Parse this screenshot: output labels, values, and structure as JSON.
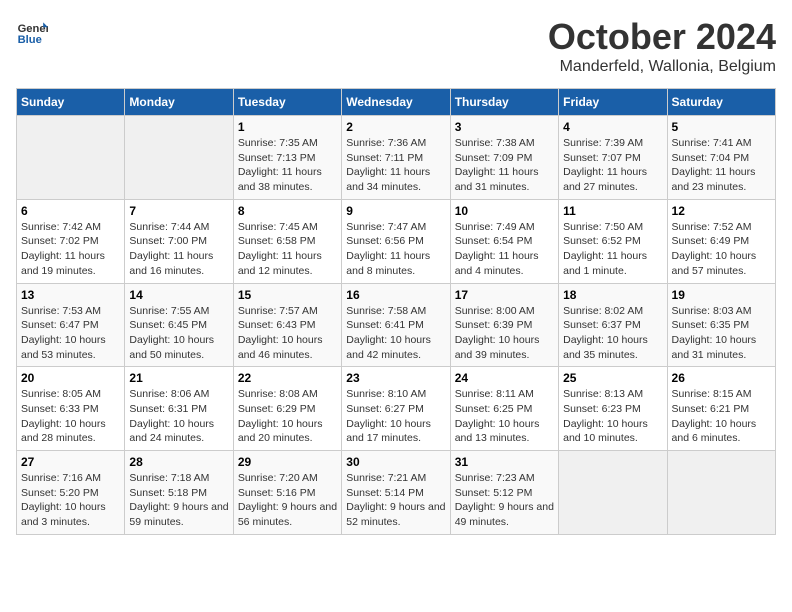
{
  "header": {
    "logo_general": "General",
    "logo_blue": "Blue",
    "month_title": "October 2024",
    "location": "Manderfeld, Wallonia, Belgium"
  },
  "days_of_week": [
    "Sunday",
    "Monday",
    "Tuesday",
    "Wednesday",
    "Thursday",
    "Friday",
    "Saturday"
  ],
  "weeks": [
    [
      {
        "num": "",
        "info": ""
      },
      {
        "num": "",
        "info": ""
      },
      {
        "num": "1",
        "info": "Sunrise: 7:35 AM\nSunset: 7:13 PM\nDaylight: 11 hours and 38 minutes."
      },
      {
        "num": "2",
        "info": "Sunrise: 7:36 AM\nSunset: 7:11 PM\nDaylight: 11 hours and 34 minutes."
      },
      {
        "num": "3",
        "info": "Sunrise: 7:38 AM\nSunset: 7:09 PM\nDaylight: 11 hours and 31 minutes."
      },
      {
        "num": "4",
        "info": "Sunrise: 7:39 AM\nSunset: 7:07 PM\nDaylight: 11 hours and 27 minutes."
      },
      {
        "num": "5",
        "info": "Sunrise: 7:41 AM\nSunset: 7:04 PM\nDaylight: 11 hours and 23 minutes."
      }
    ],
    [
      {
        "num": "6",
        "info": "Sunrise: 7:42 AM\nSunset: 7:02 PM\nDaylight: 11 hours and 19 minutes."
      },
      {
        "num": "7",
        "info": "Sunrise: 7:44 AM\nSunset: 7:00 PM\nDaylight: 11 hours and 16 minutes."
      },
      {
        "num": "8",
        "info": "Sunrise: 7:45 AM\nSunset: 6:58 PM\nDaylight: 11 hours and 12 minutes."
      },
      {
        "num": "9",
        "info": "Sunrise: 7:47 AM\nSunset: 6:56 PM\nDaylight: 11 hours and 8 minutes."
      },
      {
        "num": "10",
        "info": "Sunrise: 7:49 AM\nSunset: 6:54 PM\nDaylight: 11 hours and 4 minutes."
      },
      {
        "num": "11",
        "info": "Sunrise: 7:50 AM\nSunset: 6:52 PM\nDaylight: 11 hours and 1 minute."
      },
      {
        "num": "12",
        "info": "Sunrise: 7:52 AM\nSunset: 6:49 PM\nDaylight: 10 hours and 57 minutes."
      }
    ],
    [
      {
        "num": "13",
        "info": "Sunrise: 7:53 AM\nSunset: 6:47 PM\nDaylight: 10 hours and 53 minutes."
      },
      {
        "num": "14",
        "info": "Sunrise: 7:55 AM\nSunset: 6:45 PM\nDaylight: 10 hours and 50 minutes."
      },
      {
        "num": "15",
        "info": "Sunrise: 7:57 AM\nSunset: 6:43 PM\nDaylight: 10 hours and 46 minutes."
      },
      {
        "num": "16",
        "info": "Sunrise: 7:58 AM\nSunset: 6:41 PM\nDaylight: 10 hours and 42 minutes."
      },
      {
        "num": "17",
        "info": "Sunrise: 8:00 AM\nSunset: 6:39 PM\nDaylight: 10 hours and 39 minutes."
      },
      {
        "num": "18",
        "info": "Sunrise: 8:02 AM\nSunset: 6:37 PM\nDaylight: 10 hours and 35 minutes."
      },
      {
        "num": "19",
        "info": "Sunrise: 8:03 AM\nSunset: 6:35 PM\nDaylight: 10 hours and 31 minutes."
      }
    ],
    [
      {
        "num": "20",
        "info": "Sunrise: 8:05 AM\nSunset: 6:33 PM\nDaylight: 10 hours and 28 minutes."
      },
      {
        "num": "21",
        "info": "Sunrise: 8:06 AM\nSunset: 6:31 PM\nDaylight: 10 hours and 24 minutes."
      },
      {
        "num": "22",
        "info": "Sunrise: 8:08 AM\nSunset: 6:29 PM\nDaylight: 10 hours and 20 minutes."
      },
      {
        "num": "23",
        "info": "Sunrise: 8:10 AM\nSunset: 6:27 PM\nDaylight: 10 hours and 17 minutes."
      },
      {
        "num": "24",
        "info": "Sunrise: 8:11 AM\nSunset: 6:25 PM\nDaylight: 10 hours and 13 minutes."
      },
      {
        "num": "25",
        "info": "Sunrise: 8:13 AM\nSunset: 6:23 PM\nDaylight: 10 hours and 10 minutes."
      },
      {
        "num": "26",
        "info": "Sunrise: 8:15 AM\nSunset: 6:21 PM\nDaylight: 10 hours and 6 minutes."
      }
    ],
    [
      {
        "num": "27",
        "info": "Sunrise: 7:16 AM\nSunset: 5:20 PM\nDaylight: 10 hours and 3 minutes."
      },
      {
        "num": "28",
        "info": "Sunrise: 7:18 AM\nSunset: 5:18 PM\nDaylight: 9 hours and 59 minutes."
      },
      {
        "num": "29",
        "info": "Sunrise: 7:20 AM\nSunset: 5:16 PM\nDaylight: 9 hours and 56 minutes."
      },
      {
        "num": "30",
        "info": "Sunrise: 7:21 AM\nSunset: 5:14 PM\nDaylight: 9 hours and 52 minutes."
      },
      {
        "num": "31",
        "info": "Sunrise: 7:23 AM\nSunset: 5:12 PM\nDaylight: 9 hours and 49 minutes."
      },
      {
        "num": "",
        "info": ""
      },
      {
        "num": "",
        "info": ""
      }
    ]
  ]
}
